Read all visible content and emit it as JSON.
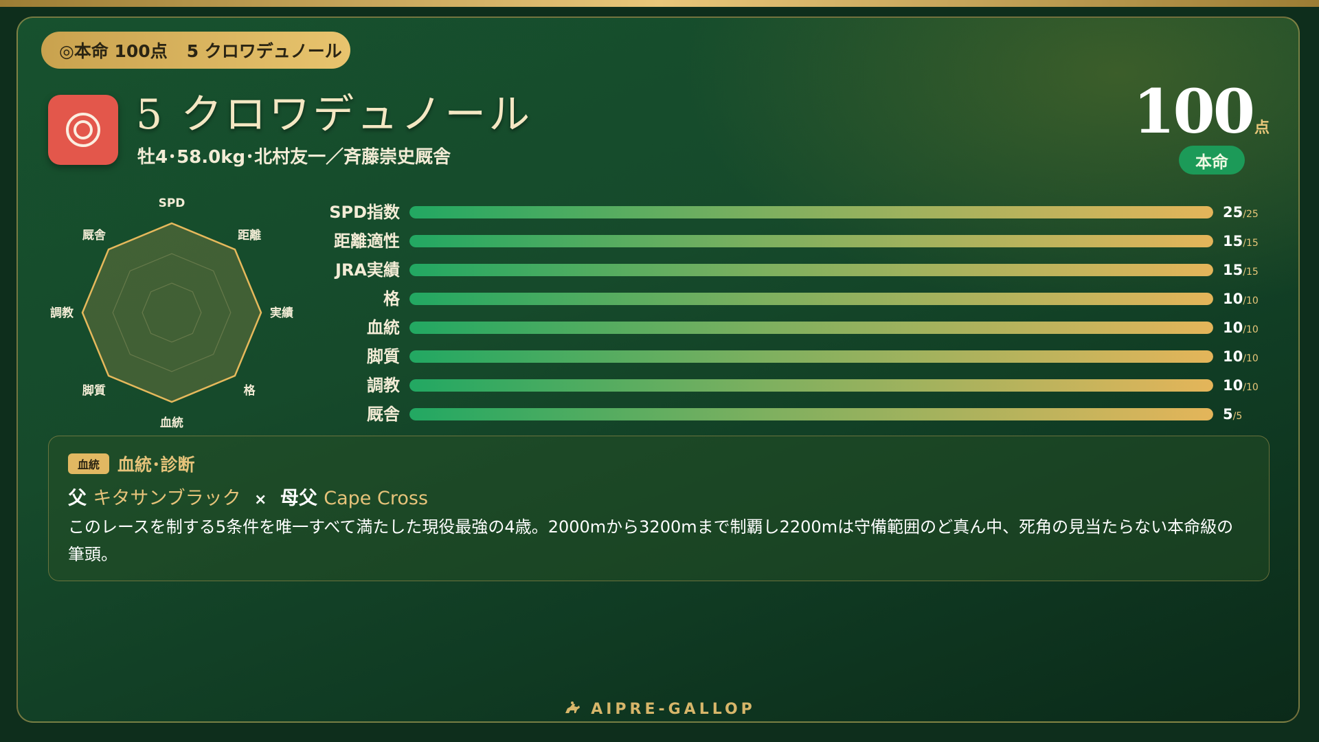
{
  "header_pill": {
    "rank_text": "◎本命 100点",
    "horse_text": "5 クロワデュノール"
  },
  "horse": {
    "mark": "◎",
    "name": "5 クロワデュノール",
    "details": "牡4･58.0kg･北村友一／斉藤崇史厩舎"
  },
  "score": {
    "value": "100",
    "unit": "点",
    "rank_label": "本命"
  },
  "radar": {
    "axes": [
      "SPD",
      "距離",
      "実績",
      "格",
      "血統",
      "脚質",
      "調教",
      "厩舎"
    ],
    "values": [
      1,
      1,
      1,
      1,
      1,
      1,
      1,
      1
    ]
  },
  "score_bars": [
    {
      "label": "SPD指数",
      "value": 25,
      "max": 25
    },
    {
      "label": "距離適性",
      "value": 15,
      "max": 15
    },
    {
      "label": "JRA実績",
      "value": 15,
      "max": 15
    },
    {
      "label": "格",
      "value": 10,
      "max": 10
    },
    {
      "label": "血統",
      "value": 10,
      "max": 10
    },
    {
      "label": "脚質",
      "value": 10,
      "max": 10
    },
    {
      "label": "調教",
      "value": 10,
      "max": 10
    },
    {
      "label": "厩舎",
      "value": 5,
      "max": 5
    }
  ],
  "diagnosis": {
    "tag": "血統",
    "title": "血統･診断",
    "sire_label": "父",
    "sire": "キタサンブラック",
    "times": "×",
    "dam_sire_label": "母父",
    "dam_sire": "Cape Cross",
    "body": "このレースを制する5条件を唯一すべて満たした現役最強の4歳。2000mから3200mまで制覇し2200mは守備範囲のど真ん中、死角の見当たらない本命級の筆頭。"
  },
  "footer": {
    "brand": "AIPRE-GALLOP",
    "icon": "horse-rider-icon"
  },
  "colors": {
    "background": "#164a2b",
    "gold": "#e1b862",
    "mark_red": "#e3574b",
    "badge_green": "#1c9a58",
    "bar_start": "#22a862",
    "bar_end": "#e4b55a"
  }
}
